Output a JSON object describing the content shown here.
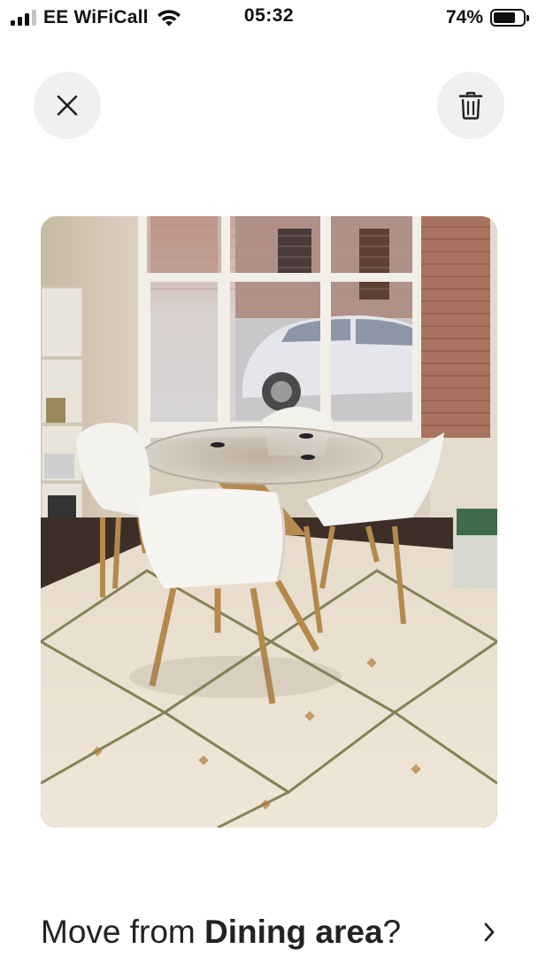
{
  "status_bar": {
    "signal_bars_active": 3,
    "carrier": "EE WiFiCall",
    "wifi_icon": "wifi-icon",
    "time": "05:32",
    "battery_percent_text": "74%",
    "battery_level": 0.74
  },
  "toolbar": {
    "close_icon": "close-icon",
    "delete_icon": "trash-icon"
  },
  "photo": {
    "subject": "dining-room-photo"
  },
  "move_prompt": {
    "prefix": "Move from ",
    "room": "Dining area",
    "suffix": "?",
    "chevron_icon": "chevron-right-icon"
  },
  "colors": {
    "button_bg": "#f0f0f0",
    "text": "#222222"
  }
}
